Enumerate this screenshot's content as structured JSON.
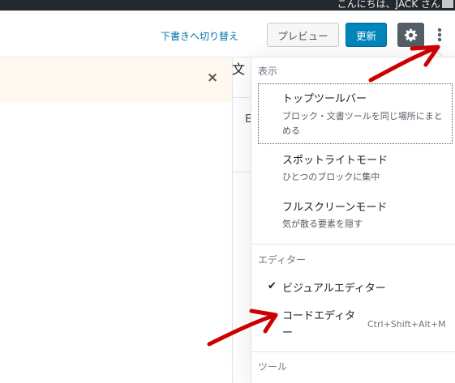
{
  "adminbar": {
    "greeting": "こんにちは、JACK さん"
  },
  "header": {
    "save_draft": "下書きへ切り替え",
    "preview": "プレビュー",
    "update": "更新",
    "settings_icon": "gear-icon",
    "more_icon": "more-vertical-icon"
  },
  "notice": {
    "close": "×"
  },
  "sidebar": {
    "tab_fragment": "文",
    "text_fragment": "E"
  },
  "menu": {
    "view": {
      "label": "表示",
      "items": [
        {
          "title": "トップツールバー",
          "desc": "ブロック・文書ツールを同じ場所にまとめる"
        },
        {
          "title": "スポットライトモード",
          "desc": "ひとつのブロックに集中"
        },
        {
          "title": "フルスクリーンモード",
          "desc": "気が散る要素を隠す"
        }
      ]
    },
    "editor": {
      "label": "エディター",
      "visual": "ビジュアルエディター",
      "visual_check": "✔",
      "code": "コードエディター",
      "code_shortcut": "Ctrl+Shift+Alt+M"
    },
    "tools": {
      "label": "ツール"
    }
  },
  "colors": {
    "accent": "#0085ba",
    "annotation": "#cc0000",
    "notice_bg": "#fef8ee"
  }
}
